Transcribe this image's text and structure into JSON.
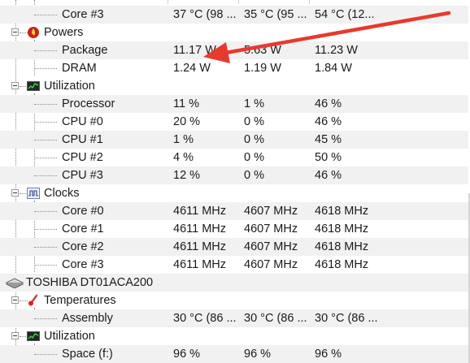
{
  "arrow_color": "#e8392e",
  "rows": {
    "core3_temp": {
      "name": "Core #3",
      "value": "37 °C  (98 ...",
      "min": "35 °C  (95 ...",
      "max": "54 °C  (12..."
    },
    "package": {
      "name": "Package",
      "value": "11.17 W",
      "min": "5.63 W",
      "max": "11.23 W"
    },
    "dram": {
      "name": "DRAM",
      "value": "1.24 W",
      "min": "1.19 W",
      "max": "1.84 W"
    },
    "processor": {
      "name": "Processor",
      "value": "11 %",
      "min": "1 %",
      "max": "46 %"
    },
    "cpu0": {
      "name": "CPU #0",
      "value": "20 %",
      "min": "0 %",
      "max": "46 %"
    },
    "cpu1": {
      "name": "CPU #1",
      "value": "1 %",
      "min": "0 %",
      "max": "45 %"
    },
    "cpu2": {
      "name": "CPU #2",
      "value": "4 %",
      "min": "0 %",
      "max": "50 %"
    },
    "cpu3": {
      "name": "CPU #3",
      "value": "12 %",
      "min": "0 %",
      "max": "46 %"
    },
    "clk0": {
      "name": "Core #0",
      "value": "4611 MHz",
      "min": "4607 MHz",
      "max": "4618 MHz"
    },
    "clk1": {
      "name": "Core #1",
      "value": "4611 MHz",
      "min": "4607 MHz",
      "max": "4618 MHz"
    },
    "clk2": {
      "name": "Core #2",
      "value": "4611 MHz",
      "min": "4607 MHz",
      "max": "4618 MHz"
    },
    "clk3": {
      "name": "Core #3",
      "value": "4611 MHz",
      "min": "4607 MHz",
      "max": "4618 MHz"
    },
    "assembly": {
      "name": "Assembly",
      "value": "30 °C  (86 ...",
      "min": "30 °C  (86 ...",
      "max": "30 °C  (86 ..."
    },
    "space": {
      "name": "Space (f:)",
      "value": "96 %",
      "min": "96 %",
      "max": "96 %"
    }
  },
  "groups": {
    "powers": "Powers",
    "utilization_cpu": "Utilization",
    "clocks": "Clocks",
    "drive": "TOSHIBA DT01ACA200",
    "temperatures": "Temperatures",
    "utilization_drive": "Utilization"
  },
  "icons": {
    "powers": "power-flame-icon",
    "utilization": "utilization-chart-icon",
    "clocks": "clock-wave-icon",
    "drive": "hard-disk-icon",
    "temperatures": "thermometer-icon"
  }
}
